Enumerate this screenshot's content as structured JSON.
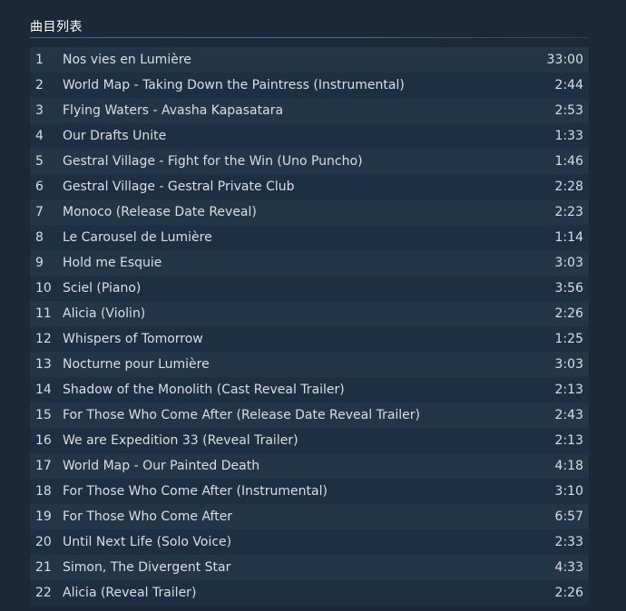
{
  "section": {
    "title": "曲目列表"
  },
  "tracks": [
    {
      "num": "1",
      "name": "Nos vies en Lumière",
      "duration": "33:00"
    },
    {
      "num": "2",
      "name": "World Map - Taking Down the Paintress (Instrumental)",
      "duration": "2:44"
    },
    {
      "num": "3",
      "name": "Flying Waters - Avasha Kapasatara",
      "duration": "2:53"
    },
    {
      "num": "4",
      "name": "Our Drafts Unite",
      "duration": "1:33"
    },
    {
      "num": "5",
      "name": "Gestral Village - Fight for the Win (Uno Puncho)",
      "duration": "1:46"
    },
    {
      "num": "6",
      "name": "Gestral Village - Gestral Private Club",
      "duration": "2:28"
    },
    {
      "num": "7",
      "name": "Monoco (Release Date Reveal)",
      "duration": "2:23"
    },
    {
      "num": "8",
      "name": "Le Carousel de Lumière",
      "duration": "1:14"
    },
    {
      "num": "9",
      "name": "Hold me Esquie",
      "duration": "3:03"
    },
    {
      "num": "10",
      "name": "Sciel (Piano)",
      "duration": "3:56"
    },
    {
      "num": "11",
      "name": "Alicia (Violin)",
      "duration": "2:26"
    },
    {
      "num": "12",
      "name": "Whispers of Tomorrow",
      "duration": "1:25"
    },
    {
      "num": "13",
      "name": "Nocturne pour Lumière",
      "duration": "3:03"
    },
    {
      "num": "14",
      "name": "Shadow of the Monolith (Cast Reveal Trailer)",
      "duration": "2:13"
    },
    {
      "num": "15",
      "name": "For Those Who Come After (Release Date Reveal Trailer)",
      "duration": "2:43"
    },
    {
      "num": "16",
      "name": "We are Expedition 33 (Reveal Trailer)",
      "duration": "2:13"
    },
    {
      "num": "17",
      "name": "World Map - Our Painted Death",
      "duration": "4:18"
    },
    {
      "num": "18",
      "name": "For Those Who Come After (Instrumental)",
      "duration": "3:10"
    },
    {
      "num": "19",
      "name": "For Those Who Come After",
      "duration": "6:57"
    },
    {
      "num": "20",
      "name": "Until Next Life (Solo Voice)",
      "duration": "2:33"
    },
    {
      "num": "21",
      "name": "Simon, The Divergent Star",
      "duration": "4:33"
    },
    {
      "num": "22",
      "name": "Alicia (Reveal Trailer)",
      "duration": "2:26"
    }
  ]
}
